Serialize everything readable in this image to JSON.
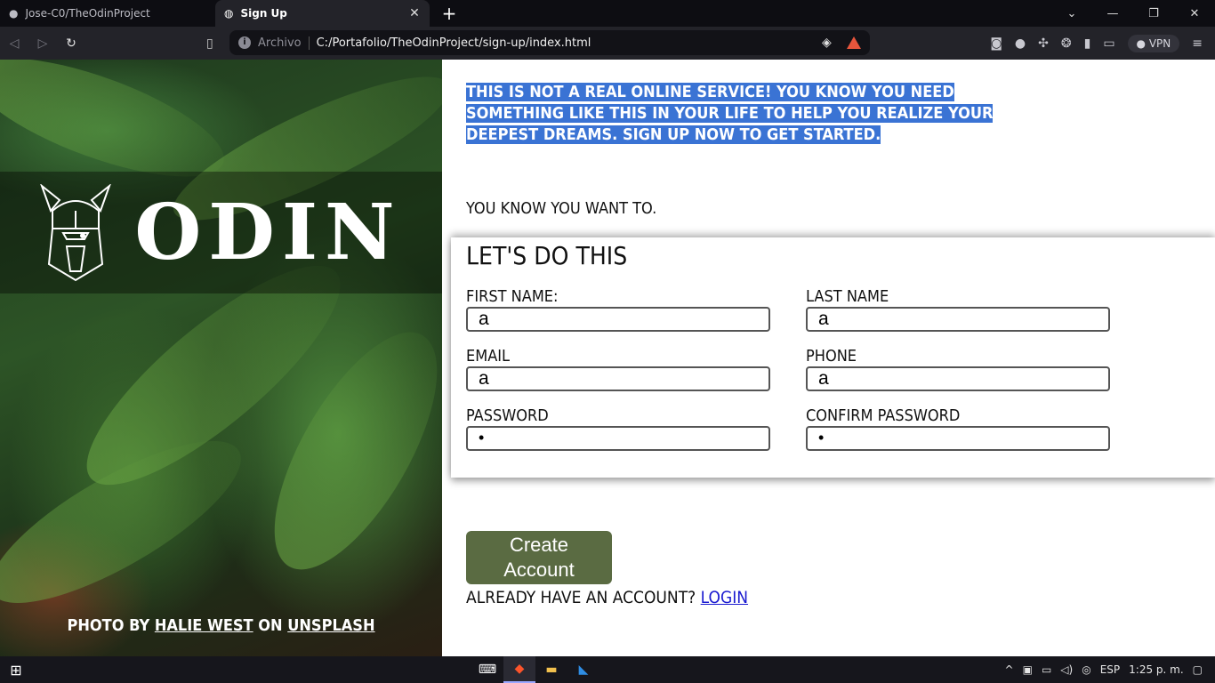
{
  "browser": {
    "tabs": [
      {
        "label": "Jose-C0/TheOdinProject",
        "active": false
      },
      {
        "label": "Sign Up",
        "active": true
      }
    ],
    "address_prefix": "Archivo",
    "url": "C:/Portafolio/TheOdinProject/sign-up/index.html",
    "vpn_label": "VPN"
  },
  "hero": {
    "logo_text": "ODIN",
    "credit_prefix": "Photo by",
    "credit_author": "Halie West",
    "credit_mid": "on",
    "credit_site": "Unsplash"
  },
  "main": {
    "intro": "This is not a real online service! You know you need something like this in your life to help you realize your deepest dreams. Sign up now to get started.",
    "want": "You know you want to.",
    "form": {
      "title": "Let's do this",
      "fields": [
        {
          "label": "First Name:",
          "value": "a"
        },
        {
          "label": "Last Name",
          "value": "a"
        },
        {
          "label": "Email",
          "value": "a"
        },
        {
          "label": "Phone",
          "value": "a"
        },
        {
          "label": "Password",
          "value": "•"
        },
        {
          "label": "Confirm Password",
          "value": "•"
        }
      ]
    },
    "create_button": "Create Account",
    "login_prompt": "Already have an account?",
    "login_link": "Login"
  },
  "taskbar": {
    "language": "ESP",
    "time": "1:25 p. m."
  },
  "colors": {
    "button_bg": "#5a6b42",
    "selection": "#3a73d4",
    "link": "#1a1ad0"
  }
}
